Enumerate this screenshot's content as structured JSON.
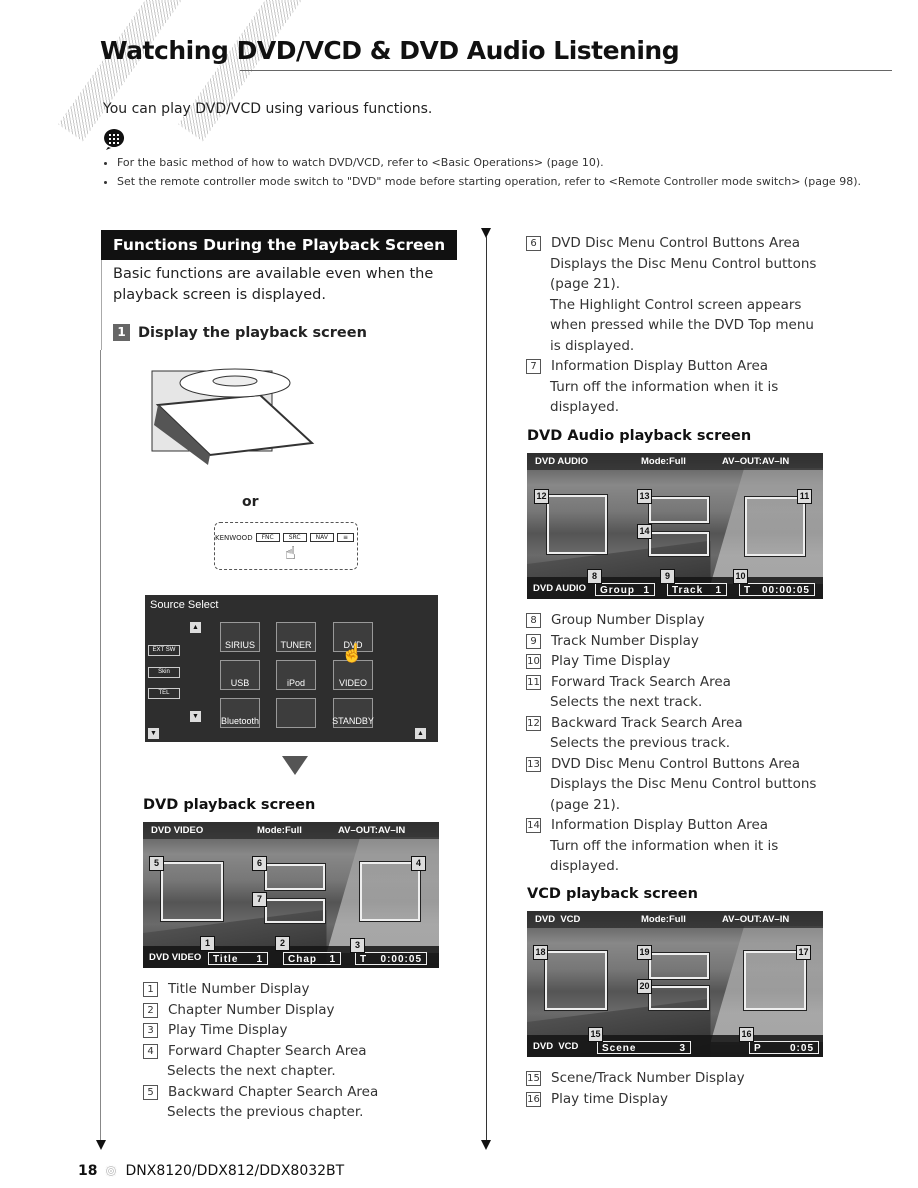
{
  "page": {
    "title": "Watching DVD/VCD & DVD Audio Listening",
    "intro": "You can play DVD/VCD using various functions.",
    "note_icon": "memo-icon",
    "notes": [
      "For the basic method of how to watch DVD/VCD, refer to <Basic Operations> (page 10).",
      "Set the remote controller mode switch to \"DVD\" mode before starting operation, refer to <Remote Controller mode switch> (page 98)."
    ]
  },
  "section": {
    "heading": "Functions During the Playback Screen",
    "body": "Basic functions are available even when the playback screen is displayed.",
    "step_number": "1",
    "step_label": "Display the playback screen",
    "or_label": "or",
    "remote_brand": "KENWOOD",
    "remote_buttons": [
      "FNC",
      "SRC",
      "NAV",
      "≡"
    ]
  },
  "source_select": {
    "title": "Source Select",
    "side_buttons": [
      "EXT SW",
      "Skin",
      "TEL"
    ],
    "tiles": [
      "SIRIUS",
      "TUNER",
      "DVD",
      "USB",
      "iPod",
      "VIDEO",
      "Bluetooth",
      "",
      "STANDBY"
    ]
  },
  "dvd_screen": {
    "heading": "DVD playback screen",
    "top_left": "DVD VIDEO",
    "top_mode": "Mode:Full",
    "top_av": "AV–OUT:AV–IN",
    "bottom_source": "DVD VIDEO",
    "fields": [
      {
        "label": "Title",
        "value": "1"
      },
      {
        "label": "Chap",
        "value": "1"
      },
      {
        "label": "T",
        "value": "0:00:05"
      }
    ],
    "tags": [
      "1",
      "2",
      "3",
      "4",
      "5",
      "6",
      "7"
    ]
  },
  "dvd_items": [
    {
      "num": "1",
      "label": "Title Number Display",
      "desc": ""
    },
    {
      "num": "2",
      "label": "Chapter Number Display",
      "desc": ""
    },
    {
      "num": "3",
      "label": "Play Time Display",
      "desc": ""
    },
    {
      "num": "4",
      "label": "Forward Chapter Search Area",
      "desc": "Selects the next chapter."
    },
    {
      "num": "5",
      "label": "Backward Chapter Search Area",
      "desc": "Selects the previous chapter."
    },
    {
      "num": "6",
      "label": "DVD Disc Menu Control Buttons Area",
      "desc": "Displays the Disc Menu Control buttons (page 21).",
      "desc2": "The Highlight Control screen appears when pressed while the DVD Top menu is displayed."
    },
    {
      "num": "7",
      "label": "Information Display Button Area",
      "desc": "Turn off the information when it is displayed."
    }
  ],
  "dvd_audio_screen": {
    "heading": "DVD Audio playback screen",
    "top_left": "DVD AUDIO",
    "top_mode": "Mode:Full",
    "top_av": "AV–OUT:AV–IN",
    "bottom_source": "DVD AUDIO",
    "fields": [
      {
        "label": "Group",
        "value": "1"
      },
      {
        "label": "Track",
        "value": "1"
      },
      {
        "label": "T",
        "value": "00:00:05"
      }
    ],
    "tags": [
      "8",
      "9",
      "10",
      "11",
      "12",
      "13",
      "14"
    ]
  },
  "dvd_audio_items": [
    {
      "num": "8",
      "label": "Group Number Display",
      "desc": ""
    },
    {
      "num": "9",
      "label": "Track Number Display",
      "desc": ""
    },
    {
      "num": "10",
      "label": "Play Time Display",
      "desc": ""
    },
    {
      "num": "11",
      "label": "Forward Track Search Area",
      "desc": "Selects the next track."
    },
    {
      "num": "12",
      "label": "Backward Track Search Area",
      "desc": "Selects the previous track."
    },
    {
      "num": "13",
      "label": "DVD Disc Menu Control Buttons Area",
      "desc": "Displays the Disc Menu Control buttons (page 21)."
    },
    {
      "num": "14",
      "label": "Information Display Button Area",
      "desc": "Turn off the information when it is displayed."
    }
  ],
  "vcd_screen": {
    "heading": "VCD playback screen",
    "top_left": "DVD  VCD",
    "top_mode": "Mode:Full",
    "top_av": "AV–OUT:AV–IN",
    "bottom_source": "DVD  VCD",
    "fields": [
      {
        "label": "Scene",
        "value": "3"
      },
      {
        "label": "P",
        "value": "0:05"
      }
    ],
    "tags": [
      "15",
      "16",
      "17",
      "18",
      "19",
      "20"
    ]
  },
  "vcd_items": [
    {
      "num": "15",
      "label": "Scene/Track Number Display",
      "desc": ""
    },
    {
      "num": "16",
      "label": "Play time Display",
      "desc": ""
    }
  ],
  "footer": {
    "page_number": "18",
    "models": "DNX8120/DDX812/DDX8032BT"
  }
}
